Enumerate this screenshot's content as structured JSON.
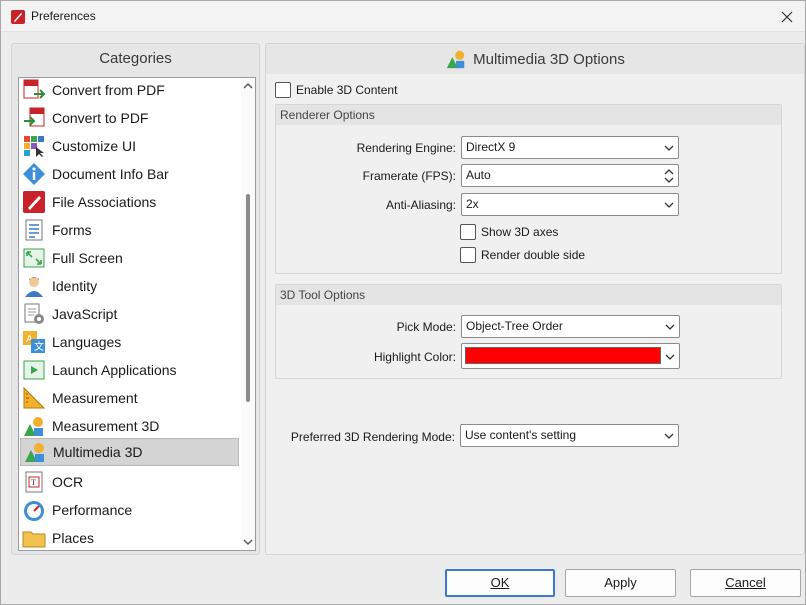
{
  "window": {
    "title": "Preferences"
  },
  "categories": {
    "header": "Categories",
    "items": [
      {
        "label": "Convert from PDF",
        "icon": "convert-from-pdf-icon"
      },
      {
        "label": "Convert to PDF",
        "icon": "convert-to-pdf-icon"
      },
      {
        "label": "Customize UI",
        "icon": "customize-ui-icon"
      },
      {
        "label": "Document Info Bar",
        "icon": "info-icon"
      },
      {
        "label": "File Associations",
        "icon": "file-associations-icon"
      },
      {
        "label": "Forms",
        "icon": "forms-icon"
      },
      {
        "label": "Full Screen",
        "icon": "full-screen-icon"
      },
      {
        "label": "Identity",
        "icon": "identity-icon"
      },
      {
        "label": "JavaScript",
        "icon": "javascript-icon"
      },
      {
        "label": "Languages",
        "icon": "languages-icon"
      },
      {
        "label": "Launch Applications",
        "icon": "launch-applications-icon"
      },
      {
        "label": "Measurement",
        "icon": "measurement-icon"
      },
      {
        "label": "Measurement 3D",
        "icon": "measurement-3d-icon"
      },
      {
        "label": "Multimedia 3D",
        "icon": "multimedia-3d-icon"
      },
      {
        "label": "OCR",
        "icon": "ocr-icon"
      },
      {
        "label": "Performance",
        "icon": "performance-icon"
      },
      {
        "label": "Places",
        "icon": "places-icon"
      }
    ],
    "selected": "Multimedia 3D"
  },
  "options": {
    "header": "Multimedia 3D Options",
    "enable_3d": {
      "label": "Enable 3D Content",
      "checked": false
    },
    "renderer": {
      "title": "Renderer Options",
      "engine_label": "Rendering Engine:",
      "engine_value": "DirectX 9",
      "framerate_label": "Framerate (FPS):",
      "framerate_value": "Auto",
      "antialias_label": "Anti-Aliasing:",
      "antialias_value": "2x",
      "show_axes": {
        "label": "Show 3D axes",
        "checked": false
      },
      "double_side": {
        "label": "Render double side",
        "checked": false
      }
    },
    "tool": {
      "title": "3D Tool Options",
      "pick_label": "Pick Mode:",
      "pick_value": "Object-Tree Order",
      "highlight_label": "Highlight Color:",
      "highlight_color": "#ff0000"
    },
    "preferred": {
      "label": "Preferred 3D Rendering Mode:",
      "value": "Use content's setting"
    }
  },
  "buttons": {
    "ok": "OK",
    "apply": "Apply",
    "cancel": "Cancel"
  },
  "colors": {
    "accent": "#3c7ac7",
    "selection": "#d4d4d4"
  }
}
